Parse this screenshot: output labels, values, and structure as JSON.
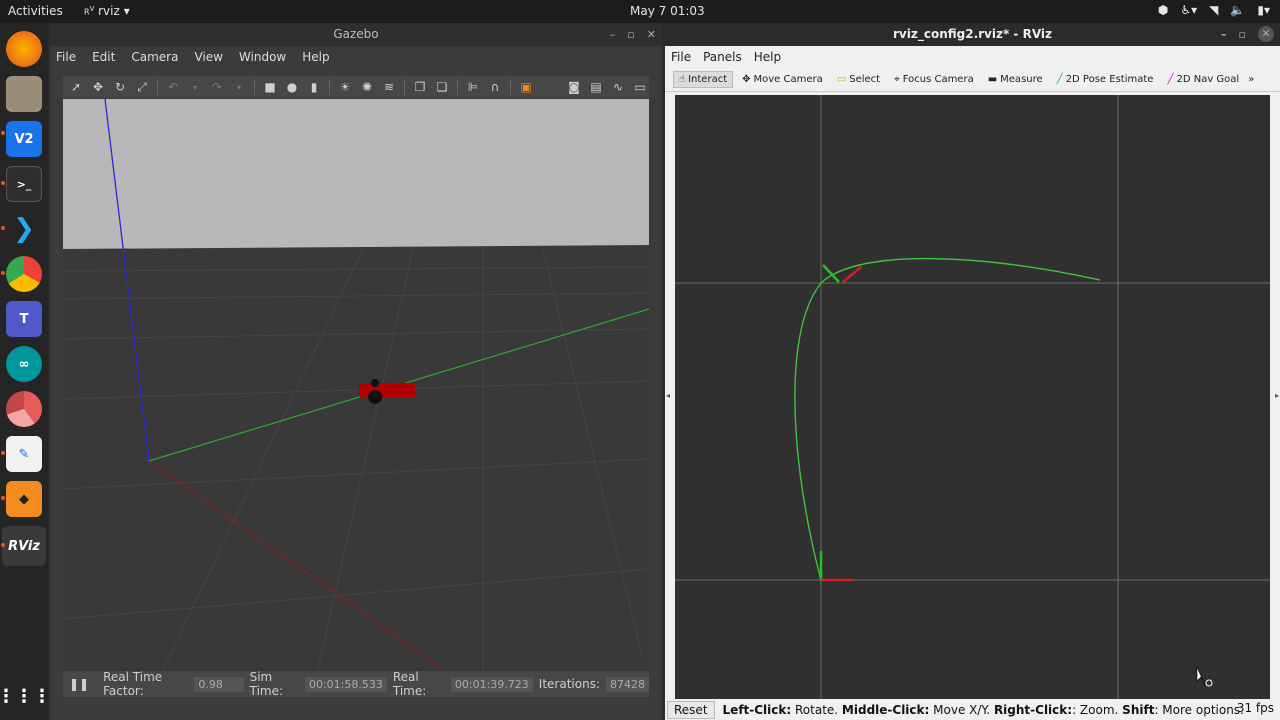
{
  "topbar": {
    "activities": "Activities",
    "app_name": "rviz",
    "clock": "May 7  01:03"
  },
  "gazebo": {
    "title": "Gazebo",
    "menu": [
      "File",
      "Edit",
      "Camera",
      "View",
      "Window",
      "Help"
    ],
    "status": {
      "rtf_label": "Real Time Factor:",
      "rtf_value": "0.98",
      "sim_label": "Sim Time:",
      "sim_value": "00:01:58.533",
      "real_label": "Real Time:",
      "real_value": "00:01:39.723",
      "iter_label": "Iterations:",
      "iter_value": "87428"
    }
  },
  "rviz": {
    "title": "rviz_config2.rviz* - RViz",
    "menu": [
      "File",
      "Panels",
      "Help"
    ],
    "tools": [
      "Interact",
      "Move Camera",
      "Select",
      "Focus Camera",
      "Measure",
      "2D Pose Estimate",
      "2D Nav Goal"
    ],
    "status": {
      "reset": "Reset",
      "lc": "Left-Click:",
      "lc_t": " Rotate. ",
      "mc": "Middle-Click:",
      "mc_t": " Move X/Y. ",
      "rc": "Right-Click:",
      "rc_t": ": Zoom. ",
      "sh": "Shift",
      "sh_t": ": More options.",
      "fps": "31 fps"
    }
  },
  "colors": {
    "path": "#3ec23e",
    "axis_x": "#d42020",
    "axis_y": "#25c025",
    "gz_sky": "#b8b8b8",
    "gz_ground": "#393939",
    "robot": "#b00000"
  }
}
